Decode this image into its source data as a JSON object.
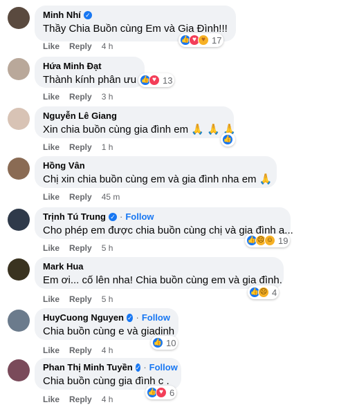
{
  "actions": {
    "like": "Like",
    "reply": "Reply"
  },
  "comments": [
    {
      "name": "Minh Nhí",
      "verified": true,
      "follow": false,
      "text": "Thầy Chia Buồn cùng Em và Gia Đình!!!",
      "time": "4 h",
      "reactions": [
        "like",
        "love",
        "care"
      ],
      "count": "17",
      "avatar_color": "#5a4a3f"
    },
    {
      "name": "Hứa Minh Đạt",
      "verified": false,
      "follow": false,
      "text": "Thành kính phân ưu",
      "time": "3 h",
      "reactions": [
        "like",
        "love"
      ],
      "count": "13",
      "avatar_color": "#b9a89a"
    },
    {
      "name": "Nguyễn Lê Giang",
      "verified": false,
      "follow": false,
      "text": "Xin chia buồn cùng gia đình em",
      "emoji": "🙏 🙏 🙏",
      "time": "1 h",
      "reactions": [
        "like"
      ],
      "count": "",
      "avatar_color": "#d8c3b5"
    },
    {
      "name": "Hồng Vân",
      "verified": false,
      "follow": false,
      "text": "Chị xin chia buồn cùng em và gia đình nha em",
      "emoji": "🙏",
      "time": "45 m",
      "reactions": [],
      "count": "",
      "avatar_color": "#8a6b54"
    },
    {
      "name": "Trịnh Tú Trung",
      "verified": true,
      "follow": true,
      "follow_label": "Follow",
      "text": "Cho phép em được chia buồn cùng chị và gia đình ạ...",
      "time": "5 h",
      "reactions": [
        "like",
        "sad",
        "haha"
      ],
      "count": "19",
      "avatar_color": "#2f3a4a"
    },
    {
      "name": "Mark Hua",
      "verified": false,
      "follow": false,
      "text": "Em ơi... cố lên nha! Chia buồn cùng em và gia đình.",
      "time": "5 h",
      "reactions": [
        "like",
        "sad"
      ],
      "count": "4",
      "avatar_color": "#3a3320"
    },
    {
      "name": "HuyCuong Nguyen",
      "verified": true,
      "follow": true,
      "follow_label": "Follow",
      "text": "Chia buồn cùng e và giadinh",
      "time": "4 h",
      "reactions": [
        "like"
      ],
      "count": "10",
      "avatar_color": "#6b7b8c"
    },
    {
      "name": "Phan Thị Minh Tuyền",
      "verified": true,
      "follow": true,
      "follow_label": "Follow",
      "text": "Chia buồn cùng gia đình c .",
      "time": "4 h",
      "reactions": [
        "like",
        "love"
      ],
      "count": "6",
      "avatar_color": "#7a4a5a"
    }
  ]
}
